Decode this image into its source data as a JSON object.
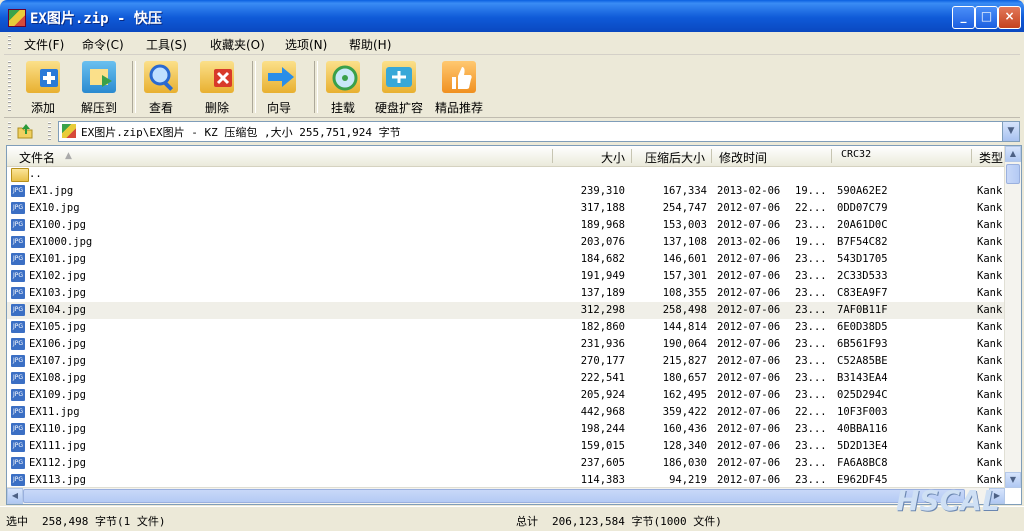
{
  "window": {
    "title": "EX图片.zip - 快压",
    "min": "_",
    "max": "□",
    "close": "×"
  },
  "menu": [
    {
      "label": "文件(F)"
    },
    {
      "label": "命令(C)"
    },
    {
      "label": "工具(S)"
    },
    {
      "label": "收藏夹(O)"
    },
    {
      "label": "选项(N)"
    },
    {
      "label": "帮助(H)"
    }
  ],
  "toolbar": [
    {
      "label": "添加",
      "icon": "add-icon",
      "color": "#2a7ad8"
    },
    {
      "label": "解压到",
      "icon": "extract-icon",
      "color": "#2aa0d8"
    },
    {
      "label": "查看",
      "icon": "view-icon",
      "color": "#3a8ee0"
    },
    {
      "label": "删除",
      "icon": "delete-icon",
      "color": "#d83a2a"
    },
    {
      "label": "向导",
      "icon": "wizard-icon",
      "color": "#2a8ee8"
    },
    {
      "label": "挂载",
      "icon": "mount-icon",
      "color": "#3aa04a"
    },
    {
      "label": "硬盘扩容",
      "icon": "disk-expand-icon",
      "color": "#38a8d8"
    },
    {
      "label": "精品推荐",
      "icon": "recommend-icon",
      "color": "#f0a030"
    }
  ],
  "address": {
    "path": "EX图片.zip\\EX图片 - KZ 压缩包 ,大小 255,751,924 字节"
  },
  "columns": {
    "name": "文件名",
    "size": "大小",
    "packed": "压缩后大小",
    "modified": "修改时间",
    "crc": "CRC32",
    "type": "类型"
  },
  "parent_row": "..",
  "files": [
    {
      "name": "EX1.jpg",
      "size": "239,310",
      "packed": "167,334",
      "date": "2013-02-06",
      "time": "19...",
      "crc": "590A62E2",
      "type": "Kank"
    },
    {
      "name": "EX10.jpg",
      "size": "317,188",
      "packed": "254,747",
      "date": "2012-07-06",
      "time": "22...",
      "crc": "0DD07C79",
      "type": "Kank"
    },
    {
      "name": "EX100.jpg",
      "size": "189,968",
      "packed": "153,003",
      "date": "2012-07-06",
      "time": "23...",
      "crc": "20A61D0C",
      "type": "Kank"
    },
    {
      "name": "EX1000.jpg",
      "size": "203,076",
      "packed": "137,108",
      "date": "2013-02-06",
      "time": "19...",
      "crc": "B7F54C82",
      "type": "Kank"
    },
    {
      "name": "EX101.jpg",
      "size": "184,682",
      "packed": "146,601",
      "date": "2012-07-06",
      "time": "23...",
      "crc": "543D1705",
      "type": "Kank"
    },
    {
      "name": "EX102.jpg",
      "size": "191,949",
      "packed": "157,301",
      "date": "2012-07-06",
      "time": "23...",
      "crc": "2C33D533",
      "type": "Kank"
    },
    {
      "name": "EX103.jpg",
      "size": "137,189",
      "packed": "108,355",
      "date": "2012-07-06",
      "time": "23...",
      "crc": "C83EA9F7",
      "type": "Kank"
    },
    {
      "name": "EX104.jpg",
      "size": "312,298",
      "packed": "258,498",
      "date": "2012-07-06",
      "time": "23...",
      "crc": "7AF0B11F",
      "type": "Kank",
      "selected": true
    },
    {
      "name": "EX105.jpg",
      "size": "182,860",
      "packed": "144,814",
      "date": "2012-07-06",
      "time": "23...",
      "crc": "6E0D38D5",
      "type": "Kank"
    },
    {
      "name": "EX106.jpg",
      "size": "231,936",
      "packed": "190,064",
      "date": "2012-07-06",
      "time": "23...",
      "crc": "6B561F93",
      "type": "Kank"
    },
    {
      "name": "EX107.jpg",
      "size": "270,177",
      "packed": "215,827",
      "date": "2012-07-06",
      "time": "23...",
      "crc": "C52A85BE",
      "type": "Kank"
    },
    {
      "name": "EX108.jpg",
      "size": "222,541",
      "packed": "180,657",
      "date": "2012-07-06",
      "time": "23...",
      "crc": "B3143EA4",
      "type": "Kank"
    },
    {
      "name": "EX109.jpg",
      "size": "205,924",
      "packed": "162,495",
      "date": "2012-07-06",
      "time": "23...",
      "crc": "025D294C",
      "type": "Kank"
    },
    {
      "name": "EX11.jpg",
      "size": "442,968",
      "packed": "359,422",
      "date": "2012-07-06",
      "time": "22...",
      "crc": "10F3F003",
      "type": "Kank"
    },
    {
      "name": "EX110.jpg",
      "size": "198,244",
      "packed": "160,436",
      "date": "2012-07-06",
      "time": "23...",
      "crc": "40BBA116",
      "type": "Kank"
    },
    {
      "name": "EX111.jpg",
      "size": "159,015",
      "packed": "128,340",
      "date": "2012-07-06",
      "time": "23...",
      "crc": "5D2D13E4",
      "type": "Kank"
    },
    {
      "name": "EX112.jpg",
      "size": "237,605",
      "packed": "186,030",
      "date": "2012-07-06",
      "time": "23...",
      "crc": "FA6A8BC8",
      "type": "Kank"
    },
    {
      "name": "EX113.jpg",
      "size": "114,383",
      "packed": "94,219",
      "date": "2012-07-06",
      "time": "23...",
      "crc": "E962DF45",
      "type": "Kank"
    }
  ],
  "status": {
    "left_label": "选中",
    "left_value": "258,498 字节(1 文件)",
    "right_label": "总计",
    "right_value": "206,123,584 字节(1000 文件)"
  },
  "watermark": "HSCAL"
}
